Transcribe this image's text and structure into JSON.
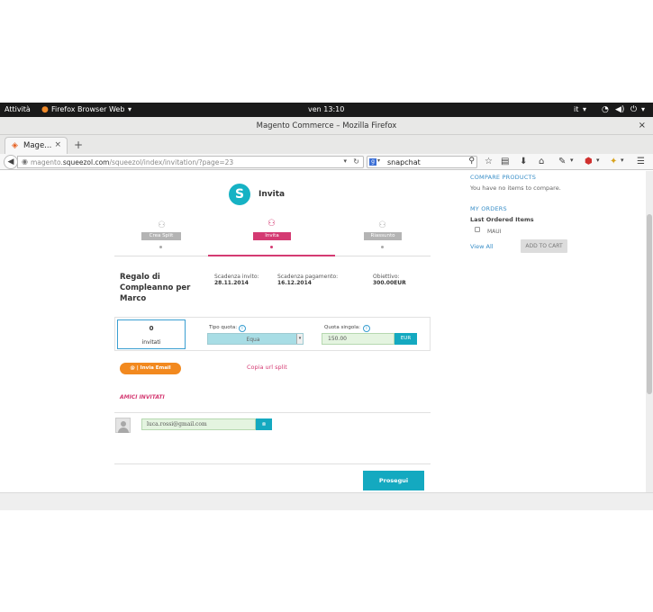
{
  "system_bar": {
    "activities": "Attività",
    "app_menu": "Firefox Browser Web",
    "clock": "ven 13:10",
    "lang": "it"
  },
  "window": {
    "title": "Magento Commerce – Mozilla Firefox",
    "close": "×"
  },
  "tab": {
    "favicon": "magento-icon",
    "label": "Mage...",
    "close": "×",
    "new_tab": "+"
  },
  "navbar": {
    "url_prefix": "magento.",
    "url_domain": "squeezol.com",
    "url_path": "/squeezol/index/invitation/?page=23",
    "search_engine": "g",
    "search_value": "snapchat"
  },
  "sidebar": {
    "compare_title": "COMPARE PRODUCTS",
    "compare_text": "You have no items to compare.",
    "orders_title": "MY ORDERS",
    "last_ordered": "Last Ordered Items",
    "item_name": "MAUI",
    "view_all": "View All",
    "add_to_cart": "ADD TO CART"
  },
  "main": {
    "logo_letter": "S",
    "logo_label": "Invita",
    "steps": [
      {
        "label": "Crea Split",
        "active": false
      },
      {
        "label": "Invita",
        "active": true
      },
      {
        "label": "Riassunto",
        "active": false
      }
    ],
    "event": {
      "title": "Regalo di Compleanno per Marco",
      "scadenza_invito_label": "Scadenza invito:",
      "scadenza_invito": "28.11.2014",
      "scadenza_pagamento_label": "Scadenza pagamento:",
      "scadenza_pagamento": "16.12.2014",
      "obiettivo_label": "Obiettivo:",
      "obiettivo": "300.00EUR"
    },
    "quota": {
      "invited_count": "0",
      "invited_label": "invitati",
      "tipo_label": "Tipo quota:",
      "tipo_value": "Equa",
      "singola_label": "Quota singola:",
      "singola_value": "150.00",
      "currency": "EUR"
    },
    "invia_email": "@ | Invia Email",
    "copia_url": "Copia url split",
    "amici_title": "AMICI INVITATI",
    "friend_email": "luca.rossi@gmail.com",
    "friend_btn": "⊗",
    "prosegui": "Prosegui"
  },
  "colors": {
    "accent_teal": "#14a9c0",
    "accent_pink": "#d43a72",
    "accent_orange": "#f2891f",
    "link_blue": "#3a8fc8"
  }
}
